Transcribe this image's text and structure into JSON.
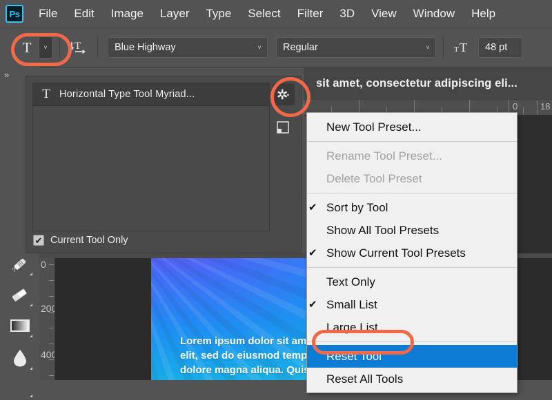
{
  "app": {
    "name": "Adobe Photoshop",
    "logo_text": "Ps",
    "logo_color": "#31c5f0"
  },
  "menubar": {
    "items": [
      {
        "label": "File"
      },
      {
        "label": "Edit"
      },
      {
        "label": "Image"
      },
      {
        "label": "Layer"
      },
      {
        "label": "Type"
      },
      {
        "label": "Select"
      },
      {
        "label": "Filter"
      },
      {
        "label": "3D"
      },
      {
        "label": "View"
      },
      {
        "label": "Window"
      },
      {
        "label": "Help"
      }
    ]
  },
  "options_bar": {
    "tool_icon": "T",
    "tool_preset_dropdown_caret": "˅",
    "orientation_icon": "text-orientation-icon",
    "font_family": {
      "value": "Blue Highway",
      "caret": "˅"
    },
    "font_style": {
      "value": "Regular",
      "caret": "˅"
    },
    "font_size_icon": "font-size-icon",
    "font_size": {
      "value": "48 pt"
    }
  },
  "toolbar": {
    "collapse_label": "»",
    "tools": [
      {
        "name": "healing-brush-tool"
      },
      {
        "name": "eraser-tool"
      },
      {
        "name": "gradient-tool"
      },
      {
        "name": "blur-tool"
      }
    ]
  },
  "tool_presets_panel": {
    "gear_icon": "gear-icon",
    "new_preset_icon": "new-preset-icon",
    "presets": [
      {
        "icon": "T",
        "label": "Horizontal Type Tool Myriad...",
        "selected": true
      }
    ],
    "current_tool_only": {
      "label": "Current Tool Only",
      "checked": true,
      "check_glyph": "✔"
    }
  },
  "document": {
    "tab_title": "sit amet, consectetur adipiscing eli...",
    "horizontal_ruler_labels": [
      "0",
      "18"
    ],
    "vertical_ruler_labels": [
      "0",
      "200",
      "400"
    ],
    "canvas_text": [
      "Lorem ipsum dolor sit am",
      "elit, sed do eiusmod temp",
      "dolore magna aliqua. Quis"
    ]
  },
  "context_menu": {
    "items": [
      {
        "label": "New Tool Preset...",
        "checked": false,
        "disabled": false,
        "selected": false
      },
      {
        "separator": true
      },
      {
        "label": "Rename Tool Preset...",
        "checked": false,
        "disabled": true,
        "selected": false
      },
      {
        "label": "Delete Tool Preset",
        "checked": false,
        "disabled": true,
        "selected": false
      },
      {
        "separator": true
      },
      {
        "label": "Sort by Tool",
        "checked": true,
        "disabled": false,
        "selected": false
      },
      {
        "label": "Show All Tool Presets",
        "checked": false,
        "disabled": false,
        "selected": false
      },
      {
        "label": "Show Current Tool Presets",
        "checked": true,
        "disabled": false,
        "selected": false
      },
      {
        "separator": true
      },
      {
        "label": "Text Only",
        "checked": false,
        "disabled": false,
        "selected": false
      },
      {
        "label": "Small List",
        "checked": true,
        "disabled": false,
        "selected": false
      },
      {
        "label": "Large List",
        "checked": false,
        "disabled": false,
        "selected": false
      },
      {
        "separator": true
      },
      {
        "label": "Reset Tool",
        "checked": false,
        "disabled": false,
        "selected": true
      },
      {
        "label": "Reset All Tools",
        "checked": false,
        "disabled": false,
        "selected": false
      }
    ],
    "check_glyph": "✔",
    "highlight_color": "#0b7bd4"
  },
  "annotations": {
    "color": "#f2694a",
    "shapes": [
      {
        "name": "tool-preset-picker-highlight"
      },
      {
        "name": "panel-menu-gear-highlight"
      },
      {
        "name": "reset-tool-highlight"
      }
    ]
  }
}
